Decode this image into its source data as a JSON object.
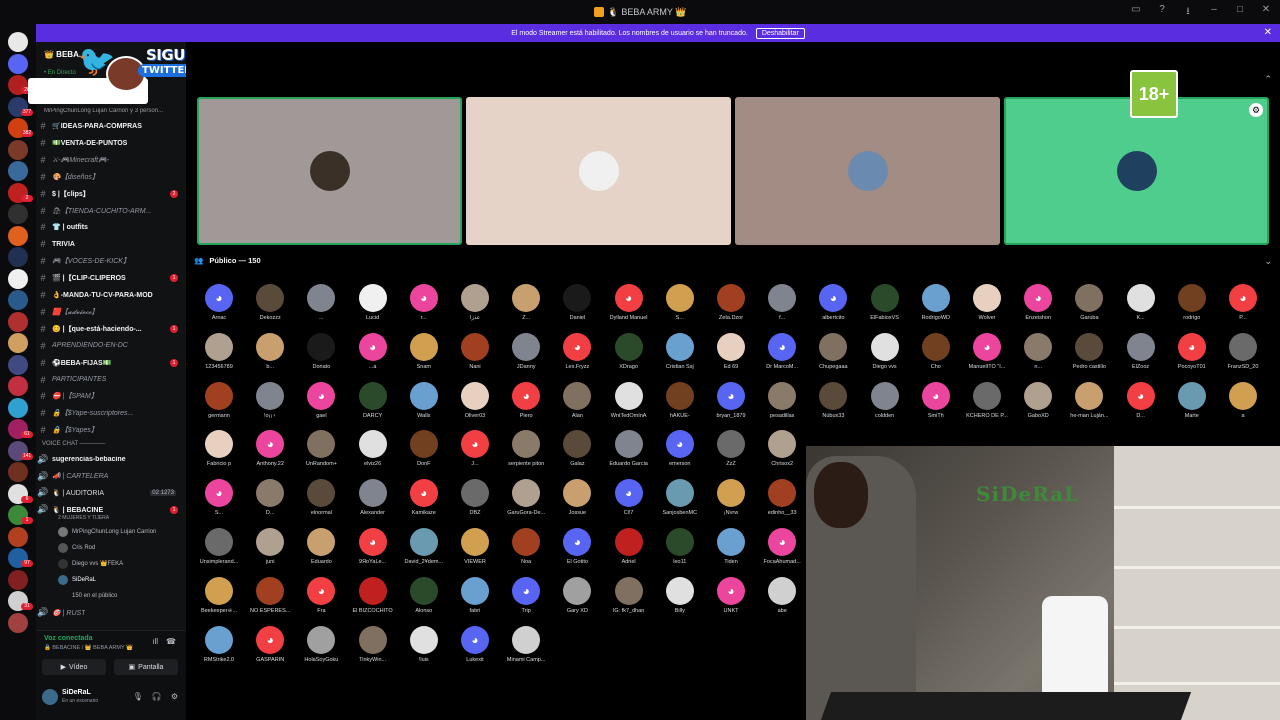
{
  "window": {
    "title": "🐧 BEBA ARMY 👑"
  },
  "banner": {
    "text": "El modo Streamer está habilitado. Los nombres de usuario se han truncado.",
    "button": "Deshabilitar"
  },
  "server": {
    "name": "👑 BEBA...",
    "live_label": "• En Directo",
    "voice_users_line": "MrPingChunLong Lujan Carrion y 3 person..."
  },
  "overlay": {
    "line1": "SIGUEME",
    "line2": "TWITTER.COM/SIDERALDOTA"
  },
  "channels": [
    {
      "label": "🛒IDEAS-PARA-COMPRAS",
      "style": "bold"
    },
    {
      "label": "💵VENTA-DE-PUNTOS",
      "style": "bold"
    },
    {
      "label": "⚔-🎮Minecraft🎮-",
      "style": "italic"
    },
    {
      "label": "🎨【diseños】",
      "style": "italic"
    },
    {
      "label": "$ |【clips】",
      "style": "bold",
      "badge": "2"
    },
    {
      "label": "🛍【TIENDA-CUCHITO-ARM...",
      "style": "italic"
    },
    {
      "label": "👕 | outfits",
      "style": "bold"
    },
    {
      "label": "TRIVIA",
      "style": "bold"
    },
    {
      "label": "🎮【VOCES-DE-KICK】",
      "style": "italic"
    },
    {
      "label": "🎬 |【CLIP-CLIPEROS",
      "style": "bold",
      "badge": "1"
    },
    {
      "label": "👌-MANDA-TU-CV-PARA-MOD",
      "style": "bold"
    },
    {
      "label": "🟥【𝓪𝓭𝓿𝓲𝓮𝓬𝓮】",
      "style": "italic"
    },
    {
      "label": "😊 |【que-está-haciendo-...",
      "style": "bold",
      "badge": "1"
    },
    {
      "label": "APRENDIENDO-EN-DC",
      "style": "italic"
    },
    {
      "label": "⚽BEBA-FIJAS💵",
      "style": "bold",
      "badge": "1"
    },
    {
      "label": "PARTICIPANTES",
      "style": "italic"
    },
    {
      "label": "⛔ |【SPAM】",
      "style": "italic"
    },
    {
      "label": "🔒【$Yape-suscriptores...",
      "style": "italic"
    },
    {
      "label": "🔒【$Yapes】",
      "style": "italic"
    }
  ],
  "voice_category": "VOICE CHAT ──────",
  "voice_channels": [
    {
      "label": "sugerencias-bebacine",
      "style": "bold"
    },
    {
      "label": "📣 | CARTELERA",
      "style": "italic"
    },
    {
      "label": "🐧 | AUDITORIA",
      "style": "normal",
      "count": "02  1273"
    },
    {
      "label": "🐧 | BEBACINE",
      "style": "bold",
      "badge": "1"
    }
  ],
  "bebacine_sub": "2 MUJERES Y TIJERA",
  "stage_users": [
    {
      "name": "MrPingChunLong Lujan Carrion"
    },
    {
      "name": "Cris Rod"
    },
    {
      "name": "Diego vvs  👑FEKA"
    },
    {
      "name": "SiDeRaL"
    },
    {
      "name": "150 en el público"
    }
  ],
  "last_channel": "🎯 | RUST",
  "voice_panel": {
    "status": "Voz conectada",
    "sub": "🔒 BEBACINE / 👑 BEBA ARMY 👑",
    "video": "Vídeo",
    "screen": "Pantalla"
  },
  "user": {
    "name": "SiDeRaL",
    "status": "En un escenario"
  },
  "stage": {
    "badge_18": "18+",
    "audience_label": "Público — 150",
    "tile_colors": [
      "#a19997",
      "#e4d3c6",
      "#a38c83",
      "#4fcd8d"
    ]
  },
  "audience": [
    [
      "Arnac",
      "Dekozzz",
      "...",
      "Lucid",
      "r...",
      "عذرا",
      "Z...",
      "Daniel",
      "Dylland Manuel",
      "S...",
      "Zeta.Dzor",
      "f...",
      "albertcito",
      "ElFabioxVS",
      "RodrigoWD",
      "Wolver",
      "Enzeishon",
      "Garuba",
      "K...",
      "rodrigo",
      "P..."
    ],
    [
      "123456789",
      "b...",
      "Donato",
      "...a",
      "Snam",
      "Nani",
      "JDanny",
      "Lex.Fryzz",
      "XDrago",
      "Cristian Ssj",
      "Ed 69",
      "Dr MarcoM...",
      "Chupegaaa",
      "Diego vvs",
      "Cho",
      "ManuelITO \"I...",
      "n...",
      "Pedro castillo",
      "ElZooz",
      "PocoyoT01",
      "FranzSD_20"
    ],
    [
      "germann",
      "!o¡¡♀",
      "gael",
      "DARCY",
      "Walls",
      "Oliver03",
      "Piero",
      "Alan",
      "WntTedOmInA",
      "hAKUE-",
      "bryan_1879",
      "pesadillas",
      "Nübux33",
      "coldden",
      "SmiTh",
      "KCHERO DE P...",
      "GaboXD",
      "he-man Luján...",
      "D...",
      "Marte",
      "a"
    ],
    [
      "Fabricio p",
      "Anthony.22",
      "UnRandom+",
      "elviz26",
      "DonF",
      "J...",
      "serpiente piton",
      "Galaz",
      "Eduardo Garcia",
      "emerson",
      "ZzZ",
      "Chrisox2"
    ],
    [
      "S...",
      "D...",
      "elnormal",
      "Alexander",
      "Kamikaze",
      "DBZ",
      "GaruGora-De...",
      "Jossue",
      "Cl!7",
      "SanjosbenMC",
      "¡Nvrw",
      "edinho__33"
    ],
    [
      "Unsimplerand...",
      "juni",
      "Eduardo",
      "9ЯoYaLe...",
      "David_2¥dem...",
      "VIEWER",
      "Noa",
      "El Gotito",
      "Adriel",
      "leo11",
      "Tiden",
      "FocaAhumad..."
    ],
    [
      "Beekeeper☠...",
      "NO ESPERES...",
      "Fra",
      "El BIZCOCHITO",
      "Alonso",
      "fabri",
      "Trip",
      "Gary XD",
      "IG: fk7_dhan",
      "Billy",
      "UNKT",
      "abe"
    ],
    [
      "RMStrike2.0",
      "GASPARIN",
      "HolaSoyGoku",
      "TinkyWin...",
      "!luis",
      "Lukexit",
      "Minami Camp..."
    ]
  ],
  "icons": {
    "titlebar_controls": [
      "inbox-icon",
      "help-icon",
      "download-icon",
      "minimize-icon",
      "maximize-icon",
      "close-icon"
    ],
    "discord_blurple": "#5865f2",
    "discord_green": "#23a55a",
    "discord_red": "#f23f43",
    "discord_orange": "#f0b232",
    "discord_pink": "#eb459e",
    "discord_gray": "#80848e"
  },
  "webcam": {
    "logo_text": "SiDeRaL"
  }
}
